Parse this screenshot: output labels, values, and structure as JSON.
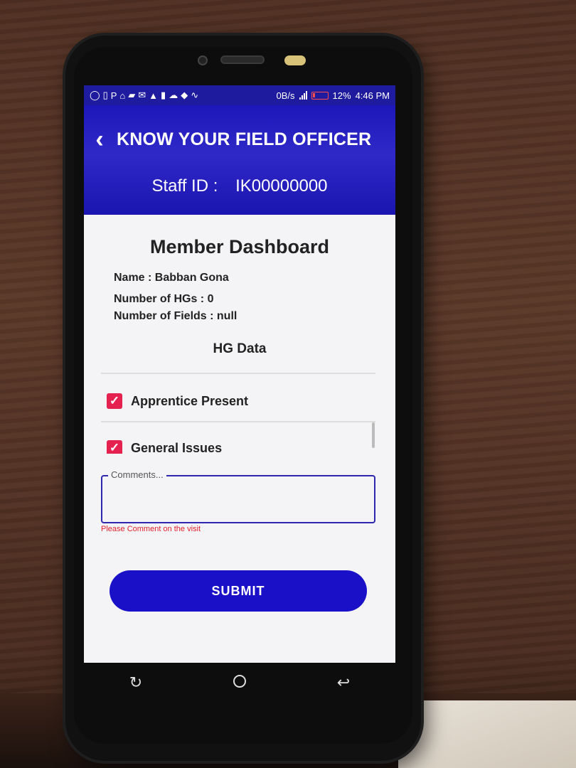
{
  "status_bar": {
    "net_speed": "0B/s",
    "battery_pct": "12%",
    "time": "4:46 PM"
  },
  "app_bar": {
    "title": "KNOW YOUR FIELD OFFICER",
    "staff_label": "Staff ID :",
    "staff_id": "IK00000000"
  },
  "dashboard": {
    "title": "Member Dashboard",
    "name_line": "Name : Babban Gona",
    "hgs_line": "Number of HGs : 0",
    "fields_line": "Number of Fields : null",
    "hg_title": "HG Data"
  },
  "checklist": [
    {
      "label": "Apprentice Present",
      "checked": true
    },
    {
      "label": "General Issues",
      "checked": true
    }
  ],
  "comment": {
    "placeholder": "Comments...",
    "value": "",
    "error": "Please Comment on the visit"
  },
  "submit_label": "SUBMIT",
  "colors": {
    "app_bar": "#1d17b9",
    "checkbox": "#e5214f",
    "submit": "#1a10c8",
    "error": "#e0202a"
  },
  "icons": {
    "back": "chevron-left-icon",
    "nav_recent": "recent-apps-icon",
    "nav_home": "home-icon",
    "nav_back": "nav-back-icon"
  }
}
